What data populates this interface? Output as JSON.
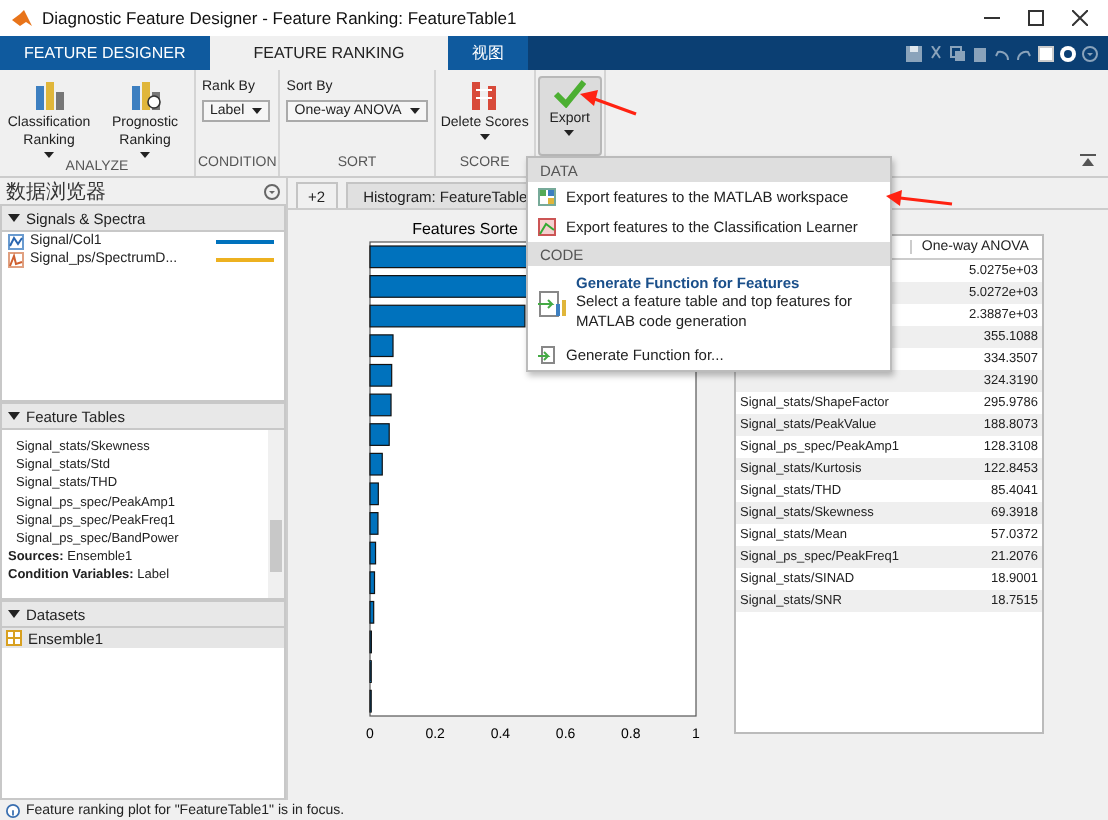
{
  "window": {
    "title": "Diagnostic Feature Designer - Feature Ranking: FeatureTable1"
  },
  "tabs": [
    {
      "label": "FEATURE DESIGNER",
      "selected": false
    },
    {
      "label": "FEATURE RANKING",
      "selected": true
    },
    {
      "label": "视图",
      "selected": false
    }
  ],
  "ribbon": {
    "groups": [
      {
        "label": "ANALYZE",
        "items": [
          {
            "kind": "menu-button",
            "label": "Classification Ranking"
          },
          {
            "kind": "menu-button",
            "label": "Prognostic Ranking"
          }
        ]
      },
      {
        "label": "CONDITION",
        "items": [
          {
            "kind": "dropdown",
            "caption": "Rank By",
            "value": "Label"
          }
        ]
      },
      {
        "label": "SORT",
        "items": [
          {
            "kind": "dropdown",
            "caption": "Sort By",
            "value": "One-way ANOVA"
          }
        ]
      },
      {
        "label": "SCORE",
        "items": [
          {
            "kind": "menu-button",
            "label": "Delete Scores"
          }
        ]
      },
      {
        "items": [
          {
            "kind": "big-button",
            "label": "Export",
            "pressed": true
          }
        ]
      }
    ]
  },
  "export_menu": {
    "sections": [
      {
        "header": "DATA",
        "items": [
          {
            "label": "Export features to the MATLAB workspace"
          },
          {
            "label": "Export features to the Classification Learner"
          }
        ]
      },
      {
        "header": "CODE",
        "items": [
          {
            "title": "Generate Function for Features",
            "description": "Select a feature table and top features for MATLAB code generation"
          },
          {
            "label": "Generate Function for..."
          }
        ]
      }
    ]
  },
  "browser": {
    "title": "数据浏览器",
    "signals": {
      "header": "Signals & Spectra",
      "items": [
        {
          "kind": "signal",
          "label": "Signal/Col1",
          "color": "#0072bd"
        },
        {
          "kind": "spectrum",
          "label": "Signal_ps/SpectrumD...",
          "color": "#edb120"
        }
      ]
    },
    "feature_tables": {
      "header": "Feature Tables",
      "items": [
        "Signal_stats/Skewness",
        "Signal_stats/Std",
        "Signal_stats/THD",
        "Signal_ps_spec/PeakAmp1",
        "Signal_ps_spec/PeakFreq1",
        "Signal_ps_spec/BandPower"
      ],
      "details": [
        {
          "label": "Sources:",
          "value": "Ensemble1"
        },
        {
          "label": "Condition Variables:",
          "value": "Label"
        }
      ]
    },
    "datasets": {
      "header": "Datasets",
      "items": [
        {
          "label": "Ensemble1",
          "selected": true
        }
      ]
    }
  },
  "doc_tabs": [
    {
      "kind": "overflow",
      "label": "+2"
    },
    {
      "kind": "tab",
      "label": "Histogram: FeatureTable"
    }
  ],
  "ranking_plot": {
    "title": "Features Sorte",
    "tick_labels": [
      "0",
      "0.2",
      "0.4",
      "0.6",
      "0.8",
      "1"
    ]
  },
  "ranking_table": {
    "value_header": "One-way ANOVA",
    "rows": [
      {
        "value": "5.0275e+03"
      },
      {
        "value": "5.0272e+03"
      },
      {
        "value": "2.3887e+03"
      },
      {
        "value": "355.1088"
      },
      {
        "value": "334.3507"
      },
      {
        "value": "324.3190"
      },
      {
        "name": "Signal_stats/ShapeFactor",
        "value": "295.9786"
      },
      {
        "name": "Signal_stats/PeakValue",
        "value": "188.8073"
      },
      {
        "name": "Signal_ps_spec/PeakAmp1",
        "value": "128.3108"
      },
      {
        "name": "Signal_stats/Kurtosis",
        "value": "122.8453"
      },
      {
        "name": "Signal_stats/THD",
        "value": "85.4041"
      },
      {
        "name": "Signal_stats/Skewness",
        "value": "69.3918"
      },
      {
        "name": "Signal_stats/Mean",
        "value": "57.0372"
      },
      {
        "name": "Signal_ps_spec/PeakFreq1",
        "value": "21.2076"
      },
      {
        "name": "Signal_stats/SINAD",
        "value": "18.9001"
      },
      {
        "name": "Signal_stats/SNR",
        "value": "18.7515"
      }
    ]
  },
  "status_bar": {
    "text": "Feature ranking plot for \"FeatureTable1\" is in focus."
  }
}
